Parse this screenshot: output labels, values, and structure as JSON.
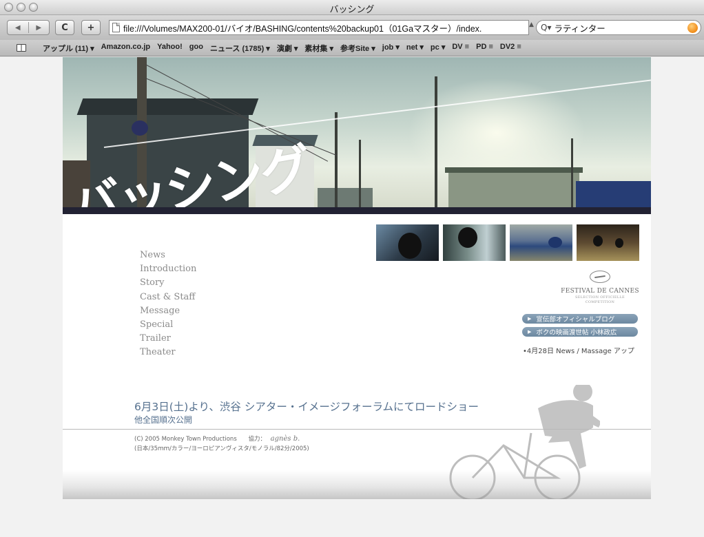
{
  "window": {
    "title": "バッシング"
  },
  "toolbar": {
    "back_icon": "back-arrow-icon",
    "forward_icon": "forward-arrow-icon",
    "reload_label": "C",
    "add_label": "+",
    "address_value": "file:///Volumes/MAX200-01/バイオ/BASHING/contents%20backup01（01Gaマスター）/index.",
    "search_value": "ラティンター",
    "search_icon_label": "Q"
  },
  "bookmarks": [
    "アップル (11) ▾",
    "Amazon.co.jp",
    "Yahoo!",
    "goo",
    "ニュース (1785) ▾",
    "演劇 ▾",
    "素材集 ▾",
    "参考Site ▾",
    "job ▾",
    "net ▾",
    "pc ▾",
    "DV ≡",
    "PD ≡",
    "DV2 ≡"
  ],
  "hero": {
    "title": "バッシング"
  },
  "nav": [
    "News",
    "Introduction",
    "Story",
    "Cast & Staff",
    "Message",
    "Special",
    "Trailer",
    "Theater"
  ],
  "cannes": {
    "title": "FESTIVAL DE CANNES",
    "sub1": "SELECTION OFFICIELLE",
    "sub2": "COMPETITION"
  },
  "links": {
    "blog": "宣伝部オフィシャルブログ",
    "kobayashi": "ボクの映画渡世帖 小林政広"
  },
  "update_note": "•4月28日 News / Massage アップ",
  "release": {
    "main": "6月3日(土)より、渋谷 シアター・イメージフォーラムにてロードショー",
    "sub": "他全国順次公開"
  },
  "credit": {
    "copyright": "(C) 2005 Monkey Town Productions",
    "cooperation_label": "協力：",
    "cooperation_sig": "agnès b.",
    "spec": "(日本/35ｍｍ/カラー/ヨーロピアンヴィスタ/モノラル/82分/2005)"
  },
  "colors": {
    "nav_text": "#8a8a8a",
    "release_text": "#55708e",
    "pill_bg": "#7a93aa"
  }
}
